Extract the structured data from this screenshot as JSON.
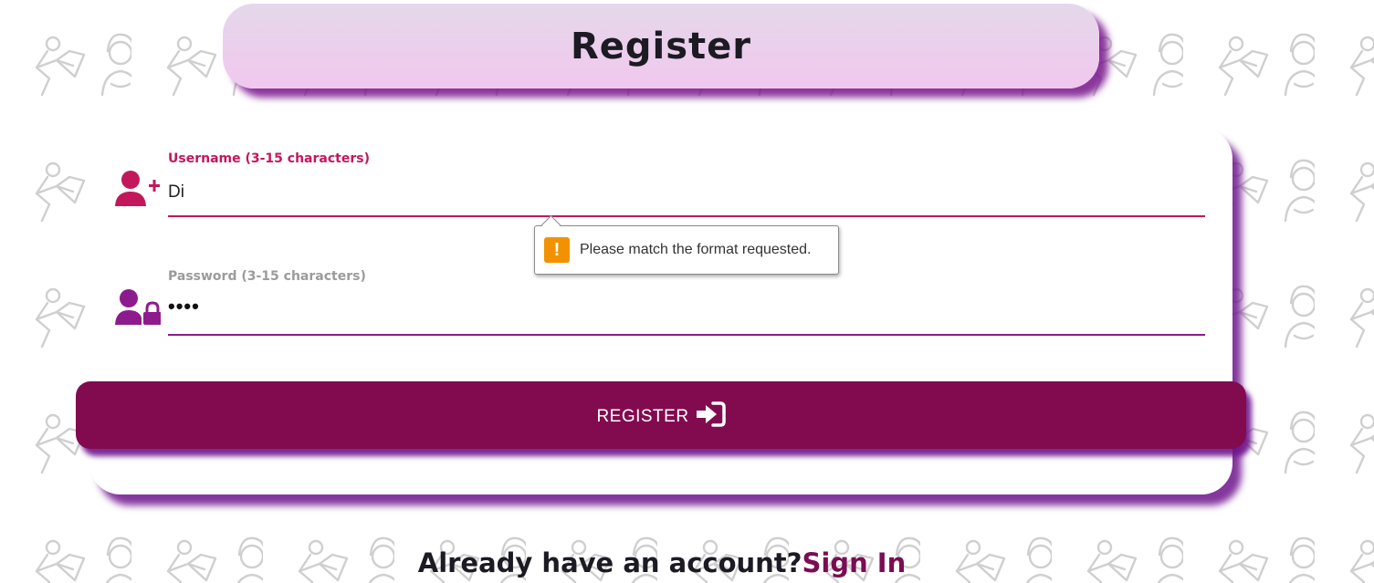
{
  "header": {
    "title": "Register"
  },
  "form": {
    "username": {
      "label": "Username (3-15 characters)",
      "value": "Di",
      "icon": "user-plus-icon"
    },
    "password": {
      "label": "Password (3-15 characters)",
      "value": "••••",
      "icon": "user-lock-icon"
    },
    "validation": {
      "message": "Please match the format requested.",
      "icon": "warning-icon",
      "icon_glyph": "!"
    },
    "submit": {
      "label": "REGISTER",
      "icon": "sign-in-icon"
    }
  },
  "footer": {
    "prompt": "Already have an account?",
    "link_label": "Sign In"
  },
  "colors": {
    "accent": "#820b50",
    "label_active": "#c2185b",
    "label_inactive": "#9b9b9b",
    "warning": "#f39200"
  }
}
